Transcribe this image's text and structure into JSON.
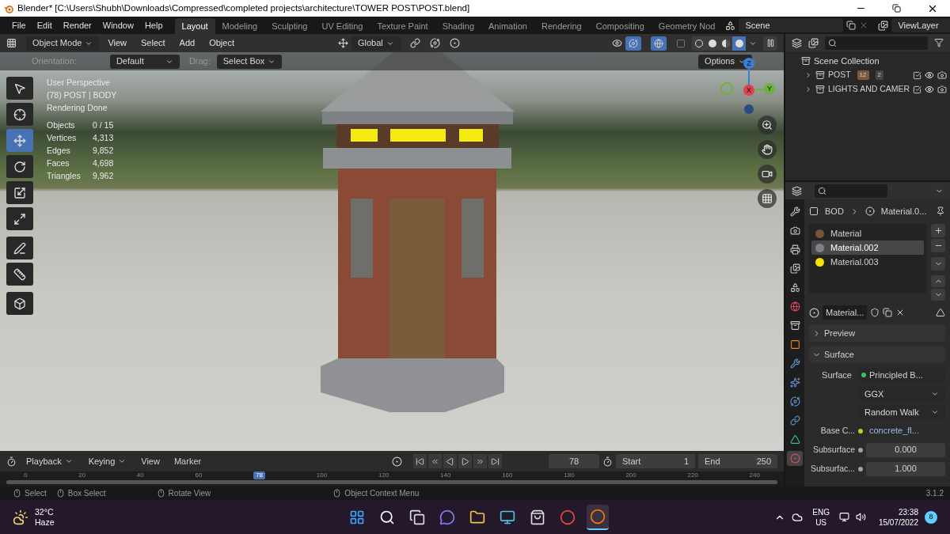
{
  "window": {
    "title": "Blender* [C:\\Users\\Shubh\\Downloads\\Compressed\\completed projects\\architecture\\TOWER POST\\POST.blend]"
  },
  "menu": [
    "File",
    "Edit",
    "Render",
    "Window",
    "Help"
  ],
  "workspaces": [
    {
      "label": "Layout",
      "selected": true
    },
    {
      "label": "Modeling",
      "selected": false
    },
    {
      "label": "Sculpting",
      "selected": false
    },
    {
      "label": "UV Editing",
      "selected": false
    },
    {
      "label": "Texture Paint",
      "selected": false
    },
    {
      "label": "Shading",
      "selected": false
    },
    {
      "label": "Animation",
      "selected": false
    },
    {
      "label": "Rendering",
      "selected": false
    },
    {
      "label": "Compositing",
      "selected": false
    },
    {
      "label": "Geometry Nod",
      "selected": false
    }
  ],
  "scene": "Scene",
  "view_layer": "ViewLayer",
  "viewport_header": {
    "mode": "Object Mode",
    "menus": [
      "View",
      "Select",
      "Add",
      "Object"
    ],
    "orientation": "Global",
    "shading": [
      {
        "kind": "wireframe",
        "selected": false
      },
      {
        "kind": "solid",
        "selected": false
      },
      {
        "kind": "material",
        "selected": false
      },
      {
        "kind": "rendered",
        "selected": true
      }
    ]
  },
  "tool_settings": {
    "orientation_label": "Orientation:",
    "orientation": "Default",
    "drag_label": "Drag:",
    "drag": "Select Box",
    "options": "Options"
  },
  "tools": [
    {
      "kind": "select",
      "selected": false
    },
    {
      "kind": "cursor",
      "selected": false
    },
    {
      "kind": "move",
      "selected": true
    },
    {
      "kind": "rotate",
      "selected": false
    },
    {
      "kind": "scale",
      "selected": false
    },
    {
      "kind": "transform",
      "selected": false
    },
    {
      "kind": "annotate",
      "selected": false
    },
    {
      "kind": "measure",
      "selected": false
    },
    {
      "kind": "add",
      "selected": false
    }
  ],
  "overlay": {
    "lines": [
      "User Perspective",
      "(78) POST | BODY",
      "Rendering Done"
    ],
    "stats": [
      {
        "label": "Objects",
        "value": "0 / 15"
      },
      {
        "label": "Vertices",
        "value": "4,313"
      },
      {
        "label": "Edges",
        "value": "9,852"
      },
      {
        "label": "Faces",
        "value": "4,698"
      },
      {
        "label": "Triangles",
        "value": "9,962"
      }
    ]
  },
  "gizmo_axes": [
    "Z",
    "X",
    "Y"
  ],
  "outliner": {
    "root": "Scene Collection",
    "items": [
      {
        "name": "POST",
        "expanded": false,
        "counts": [
          "12",
          "2"
        ],
        "visible": true
      },
      {
        "name": "LIGHTS AND CAMER",
        "expanded": false,
        "visible": true
      }
    ]
  },
  "property_tabs": [
    {
      "kind": "tool",
      "selected": false
    },
    {
      "kind": "render",
      "selected": false
    },
    {
      "kind": "output",
      "selected": false
    },
    {
      "kind": "view",
      "selected": false
    },
    {
      "kind": "scene",
      "selected": false
    },
    {
      "kind": "world",
      "selected": false
    },
    {
      "kind": "collection",
      "selected": false
    },
    {
      "kind": "object",
      "selected": false
    },
    {
      "kind": "modifier",
      "selected": false
    },
    {
      "kind": "particles",
      "selected": false
    },
    {
      "kind": "physics",
      "selected": false
    },
    {
      "kind": "constraints",
      "selected": false
    },
    {
      "kind": "data",
      "selected": false
    },
    {
      "kind": "material",
      "selected": true
    }
  ],
  "properties": {
    "breadcrumb": [
      "BOD",
      "Material.0..."
    ],
    "materials": [
      {
        "name": "Material",
        "color": "#7a5238",
        "selected": false
      },
      {
        "name": "Material.002",
        "color": "#7d8288",
        "selected": true
      },
      {
        "name": "Material.003",
        "color": "#f2e600",
        "selected": false
      }
    ],
    "material_name": "Material...",
    "panels": [
      {
        "title": "Preview",
        "expanded": false
      },
      {
        "title": "Surface",
        "expanded": true
      }
    ],
    "surface_label": "Surface",
    "surface": "Principled B...",
    "distribution": "GGX",
    "subsurface_method": "Random Walk",
    "fields": [
      {
        "kind": "link",
        "label": "Base C...",
        "value": "concrete_fl..."
      },
      {
        "kind": "number",
        "label": "Subsurface",
        "value": "0.000"
      },
      {
        "kind": "number",
        "label": "Subsurfac...",
        "value": "1.000"
      }
    ]
  },
  "timeline": {
    "menus": [
      "Playback",
      "Keying",
      "View",
      "Marker"
    ],
    "current": "78",
    "start_label": "Start",
    "start": "1",
    "end_label": "End",
    "end": "250",
    "ticks": [
      "0",
      "20",
      "40",
      "60",
      "100",
      "120",
      "140",
      "160",
      "180",
      "200",
      "220",
      "240"
    ],
    "marker": "78"
  },
  "status": {
    "hints": [
      "Select",
      "Box Select",
      "Rotate View",
      "Object Context Menu"
    ],
    "version": "3.1.2"
  },
  "taskbar": {
    "temp": "32°C",
    "weather": "Haze",
    "apps": [
      {
        "kind": "start",
        "active": false
      },
      {
        "kind": "search",
        "active": false
      },
      {
        "kind": "taskview",
        "active": false
      },
      {
        "kind": "chat",
        "active": false
      },
      {
        "kind": "folder",
        "active": false
      },
      {
        "kind": "monitor",
        "active": false
      },
      {
        "kind": "store",
        "active": false
      },
      {
        "kind": "browser",
        "active": false
      },
      {
        "kind": "blender",
        "active": true
      }
    ],
    "lang": "ENG",
    "region": "US",
    "time": "23:38",
    "date": "15/07/2022",
    "badge": "8"
  }
}
